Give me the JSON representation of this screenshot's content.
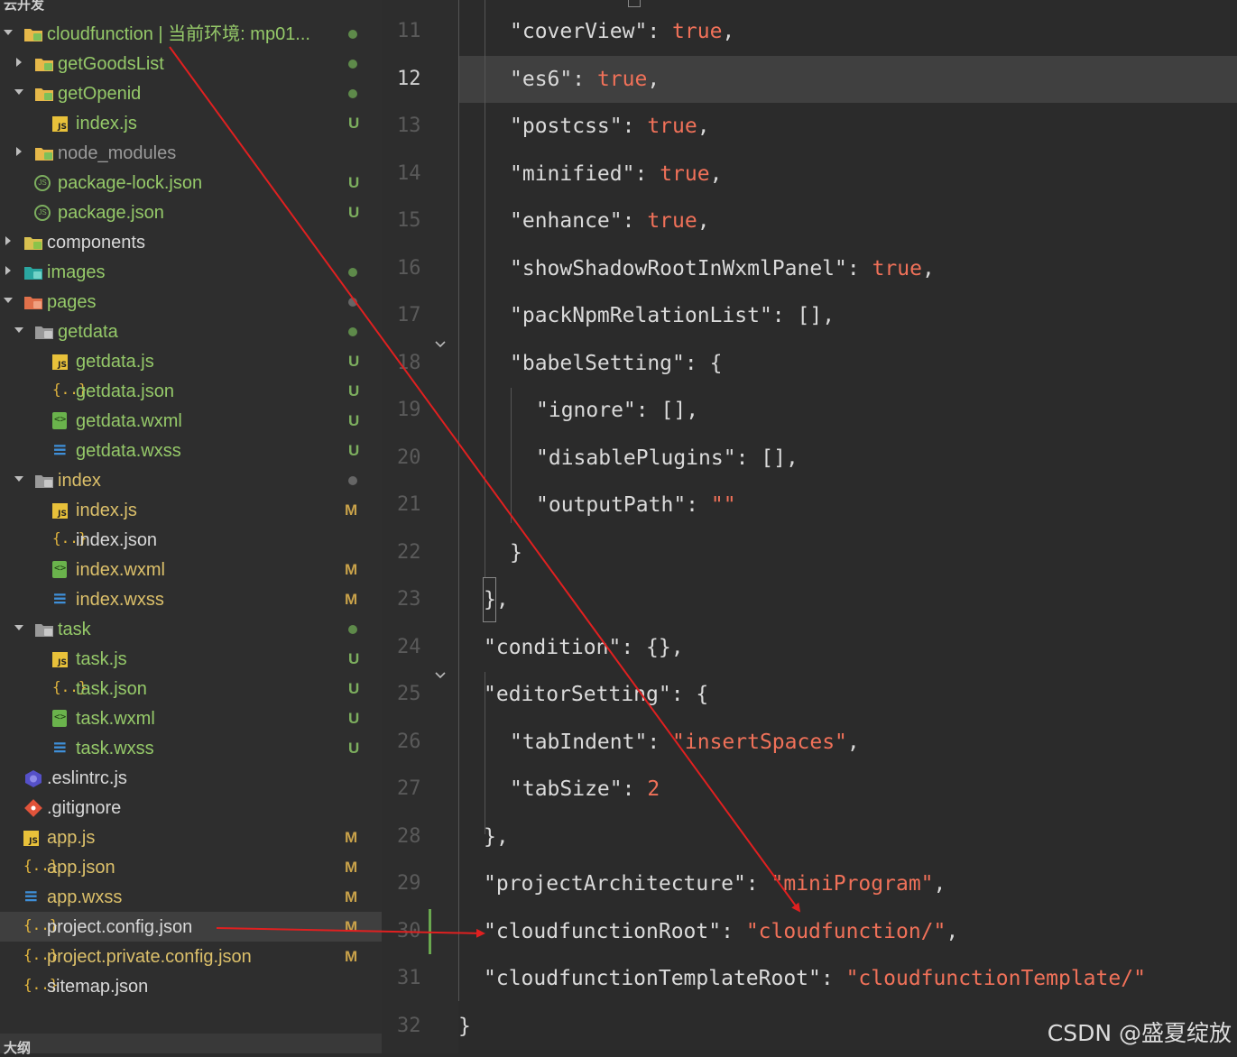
{
  "explorer": {
    "section_title": "云开发",
    "outline_title": "大纲",
    "items": [
      {
        "label": "cloudfunction | 当前环境: mp01...",
        "status": "",
        "twisty": "open",
        "icon": "folder-cloud-icon",
        "color": "green",
        "indent": 0
      },
      {
        "label": "getGoodsList",
        "status": "",
        "twisty": "closed",
        "icon": "folder-cloud-icon",
        "color": "green",
        "indent": 1
      },
      {
        "label": "getOpenid",
        "status": "",
        "twisty": "open",
        "icon": "folder-cloud-icon",
        "color": "green",
        "indent": 1
      },
      {
        "label": "index.js",
        "status": "U",
        "twisty": "",
        "icon": "js-icon",
        "color": "green",
        "indent": 2
      },
      {
        "label": "node_modules",
        "status": "",
        "twisty": "closed",
        "icon": "folder-cloud-icon",
        "color": "grey",
        "indent": 1
      },
      {
        "label": "package-lock.json",
        "status": "U",
        "twisty": "",
        "icon": "npm-icon",
        "color": "green",
        "indent": 1
      },
      {
        "label": "package.json",
        "status": "U",
        "twisty": "",
        "icon": "npm-icon",
        "color": "green",
        "indent": 1
      },
      {
        "label": "components",
        "status": "",
        "twisty": "closed",
        "icon": "folder-components-icon",
        "color": "white",
        "indent": 0
      },
      {
        "label": "images",
        "status": "",
        "twisty": "closed",
        "icon": "folder-images-icon",
        "color": "green",
        "indent": 0
      },
      {
        "label": "pages",
        "status": "",
        "twisty": "open",
        "icon": "folder-pages-icon",
        "color": "green",
        "indent": 0
      },
      {
        "label": "getdata",
        "status": "",
        "twisty": "open",
        "icon": "folder-open-icon",
        "color": "green",
        "indent": 1
      },
      {
        "label": "getdata.js",
        "status": "U",
        "twisty": "",
        "icon": "js-icon",
        "color": "green",
        "indent": 2
      },
      {
        "label": "getdata.json",
        "status": "U",
        "twisty": "",
        "icon": "json-icon",
        "color": "green",
        "indent": 2
      },
      {
        "label": "getdata.wxml",
        "status": "U",
        "twisty": "",
        "icon": "wxml-icon",
        "color": "green",
        "indent": 2
      },
      {
        "label": "getdata.wxss",
        "status": "U",
        "twisty": "",
        "icon": "wxss-icon",
        "color": "green",
        "indent": 2
      },
      {
        "label": "index",
        "status": "",
        "twisty": "open",
        "icon": "folder-open-icon",
        "color": "yellow",
        "indent": 1
      },
      {
        "label": "index.js",
        "status": "M",
        "twisty": "",
        "icon": "js-icon",
        "color": "yellow",
        "indent": 2
      },
      {
        "label": "index.json",
        "status": "",
        "twisty": "",
        "icon": "json-icon",
        "color": "white",
        "indent": 2
      },
      {
        "label": "index.wxml",
        "status": "M",
        "twisty": "",
        "icon": "wxml-icon",
        "color": "yellow",
        "indent": 2
      },
      {
        "label": "index.wxss",
        "status": "M",
        "twisty": "",
        "icon": "wxss-icon",
        "color": "yellow",
        "indent": 2
      },
      {
        "label": "task",
        "status": "",
        "twisty": "open",
        "icon": "folder-open-icon",
        "color": "green",
        "indent": 1
      },
      {
        "label": "task.js",
        "status": "U",
        "twisty": "",
        "icon": "js-icon",
        "color": "green",
        "indent": 2
      },
      {
        "label": "task.json",
        "status": "U",
        "twisty": "",
        "icon": "json-icon",
        "color": "green",
        "indent": 2
      },
      {
        "label": "task.wxml",
        "status": "U",
        "twisty": "",
        "icon": "wxml-icon",
        "color": "green",
        "indent": 2
      },
      {
        "label": "task.wxss",
        "status": "U",
        "twisty": "",
        "icon": "wxss-icon",
        "color": "green",
        "indent": 2
      },
      {
        "label": ".eslintrc.js",
        "status": "",
        "twisty": "",
        "icon": "eslint-icon",
        "color": "white",
        "indent": 0
      },
      {
        "label": ".gitignore",
        "status": "",
        "twisty": "",
        "icon": "git-icon",
        "color": "white",
        "indent": 0
      },
      {
        "label": "app.js",
        "status": "M",
        "twisty": "",
        "icon": "js-icon",
        "color": "yellow",
        "indent": 0
      },
      {
        "label": "app.json",
        "status": "M",
        "twisty": "",
        "icon": "json-icon",
        "color": "yellow",
        "indent": 0
      },
      {
        "label": "app.wxss",
        "status": "M",
        "twisty": "",
        "icon": "wxss-icon",
        "color": "yellow",
        "indent": 0
      },
      {
        "label": "project.config.json",
        "status": "M",
        "twisty": "",
        "icon": "json-icon",
        "color": "white",
        "indent": 0,
        "selected": true
      },
      {
        "label": "project.private.config.json",
        "status": "M",
        "twisty": "",
        "icon": "json-icon",
        "color": "yellow",
        "indent": 0
      },
      {
        "label": "sitemap.json",
        "status": "",
        "twisty": "",
        "icon": "json-icon",
        "color": "white",
        "indent": 0
      }
    ],
    "dots": {
      "0": "green",
      "1": "green",
      "2": "green",
      "8": "green",
      "9": "grey",
      "10": "green",
      "15": "grey",
      "20": "green"
    }
  },
  "editor": {
    "current_line": 12,
    "lines": [
      {
        "n": "11",
        "indent": 2,
        "tokens": [
          [
            "k",
            "\"coverView\""
          ],
          [
            "p",
            ": "
          ],
          [
            "v",
            "true"
          ],
          [
            "p",
            ","
          ]
        ]
      },
      {
        "n": "12",
        "indent": 2,
        "tokens": [
          [
            "k",
            "\"es6\""
          ],
          [
            "p",
            ": "
          ],
          [
            "v",
            "true"
          ],
          [
            "p",
            ","
          ]
        ]
      },
      {
        "n": "13",
        "indent": 2,
        "tokens": [
          [
            "k",
            "\"postcss\""
          ],
          [
            "p",
            ": "
          ],
          [
            "v",
            "true"
          ],
          [
            "p",
            ","
          ]
        ]
      },
      {
        "n": "14",
        "indent": 2,
        "tokens": [
          [
            "k",
            "\"minified\""
          ],
          [
            "p",
            ": "
          ],
          [
            "v",
            "true"
          ],
          [
            "p",
            ","
          ]
        ]
      },
      {
        "n": "15",
        "indent": 2,
        "tokens": [
          [
            "k",
            "\"enhance\""
          ],
          [
            "p",
            ": "
          ],
          [
            "v",
            "true"
          ],
          [
            "p",
            ","
          ]
        ]
      },
      {
        "n": "16",
        "indent": 2,
        "tokens": [
          [
            "k",
            "\"showShadowRootInWxmlPanel\""
          ],
          [
            "p",
            ": "
          ],
          [
            "v",
            "true"
          ],
          [
            "p",
            ","
          ]
        ]
      },
      {
        "n": "17",
        "indent": 2,
        "tokens": [
          [
            "k",
            "\"packNpmRelationList\""
          ],
          [
            "p",
            ": "
          ],
          [
            "b",
            "[]"
          ],
          [
            "p",
            ","
          ]
        ]
      },
      {
        "n": "18",
        "indent": 2,
        "tokens": [
          [
            "k",
            "\"babelSetting\""
          ],
          [
            "p",
            ": "
          ],
          [
            "b",
            "{"
          ]
        ]
      },
      {
        "n": "19",
        "indent": 3,
        "tokens": [
          [
            "k",
            "\"ignore\""
          ],
          [
            "p",
            ": "
          ],
          [
            "b",
            "[]"
          ],
          [
            "p",
            ","
          ]
        ]
      },
      {
        "n": "20",
        "indent": 3,
        "tokens": [
          [
            "k",
            "\"disablePlugins\""
          ],
          [
            "p",
            ": "
          ],
          [
            "b",
            "[]"
          ],
          [
            "p",
            ","
          ]
        ]
      },
      {
        "n": "21",
        "indent": 3,
        "tokens": [
          [
            "k",
            "\"outputPath\""
          ],
          [
            "p",
            ": "
          ],
          [
            "v",
            "\"\""
          ]
        ]
      },
      {
        "n": "22",
        "indent": 2,
        "tokens": [
          [
            "b",
            "}"
          ]
        ]
      },
      {
        "n": "23",
        "indent": 1,
        "tokens": [
          [
            "b",
            "}"
          ],
          [
            "p",
            ","
          ]
        ]
      },
      {
        "n": "24",
        "indent": 1,
        "tokens": [
          [
            "k",
            "\"condition\""
          ],
          [
            "p",
            ": "
          ],
          [
            "b",
            "{}"
          ],
          [
            "p",
            ","
          ]
        ]
      },
      {
        "n": "25",
        "indent": 1,
        "tokens": [
          [
            "k",
            "\"editorSetting\""
          ],
          [
            "p",
            ": "
          ],
          [
            "b",
            "{"
          ]
        ]
      },
      {
        "n": "26",
        "indent": 2,
        "tokens": [
          [
            "k",
            "\"tabIndent\""
          ],
          [
            "p",
            ": "
          ],
          [
            "v",
            "\"insertSpaces\""
          ],
          [
            "p",
            ","
          ]
        ]
      },
      {
        "n": "27",
        "indent": 2,
        "tokens": [
          [
            "k",
            "\"tabSize\""
          ],
          [
            "p",
            ": "
          ],
          [
            "v",
            "2"
          ]
        ]
      },
      {
        "n": "28",
        "indent": 1,
        "tokens": [
          [
            "b",
            "}"
          ],
          [
            "p",
            ","
          ]
        ]
      },
      {
        "n": "29",
        "indent": 1,
        "tokens": [
          [
            "k",
            "\"projectArchitecture\""
          ],
          [
            "p",
            ": "
          ],
          [
            "v",
            "\"miniProgram\""
          ],
          [
            "p",
            ","
          ]
        ]
      },
      {
        "n": "30",
        "indent": 1,
        "tokens": [
          [
            "k",
            "\"cloudfunctionRoot\""
          ],
          [
            "p",
            ": "
          ],
          [
            "v",
            "\"cloudfunction/\""
          ],
          [
            "p",
            ","
          ]
        ]
      },
      {
        "n": "31",
        "indent": 1,
        "tokens": [
          [
            "k",
            "\"cloudfunctionTemplateRoot\""
          ],
          [
            "p",
            ": "
          ],
          [
            "v",
            "\"cloudfunctionTemplate/\""
          ]
        ]
      },
      {
        "n": "32",
        "indent": 0,
        "tokens": [
          [
            "b",
            "}"
          ]
        ]
      }
    ]
  },
  "watermark": "CSDN @盛夏绽放",
  "colors": {
    "key": "#dadada",
    "value": "#f07159",
    "arrow": "#e02020",
    "added": "#6aa84f"
  }
}
